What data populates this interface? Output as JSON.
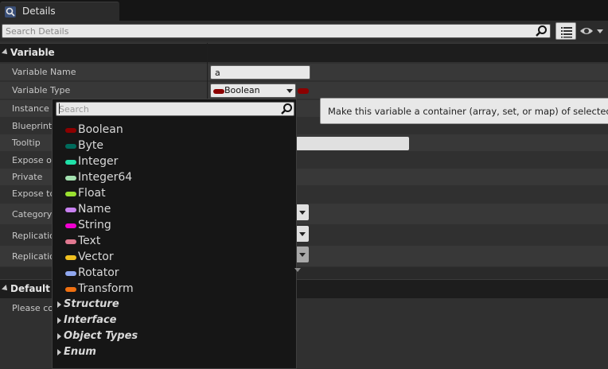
{
  "tab": {
    "title": "Details"
  },
  "search": {
    "placeholder": "Search Details"
  },
  "sections": {
    "variable": "Variable",
    "default_value": "Default V"
  },
  "rows": [
    {
      "label": "Variable Name"
    },
    {
      "label": "Variable Type"
    },
    {
      "label": "Instance E"
    },
    {
      "label": "Blueprint R"
    },
    {
      "label": "Tooltip"
    },
    {
      "label": "Expose on"
    },
    {
      "label": "Private"
    },
    {
      "label": "Expose to"
    },
    {
      "label": "Category"
    },
    {
      "label": "Replication"
    },
    {
      "label": "Replicatio"
    }
  ],
  "variable_name_value": "a",
  "variable_type_value": "Boolean",
  "default_value_note": "Please co",
  "container_tooltip": "Make this variable a container (array, set, or map) of selected type",
  "type_popup": {
    "search_placeholder": "Search",
    "types": [
      {
        "label": "Boolean",
        "color": "#8c0000"
      },
      {
        "label": "Byte",
        "color": "#006b5c"
      },
      {
        "label": "Integer",
        "color": "#1fe0a8"
      },
      {
        "label": "Integer64",
        "color": "#a3e0b0"
      },
      {
        "label": "Float",
        "color": "#9ae030"
      },
      {
        "label": "Name",
        "color": "#c880f0"
      },
      {
        "label": "String",
        "color": "#f000d0"
      },
      {
        "label": "Text",
        "color": "#e07890"
      },
      {
        "label": "Vector",
        "color": "#f0c020"
      },
      {
        "label": "Rotator",
        "color": "#90a8f0"
      },
      {
        "label": "Transform",
        "color": "#f07010"
      }
    ],
    "categories": [
      {
        "label": "Structure"
      },
      {
        "label": "Interface"
      },
      {
        "label": "Object Types"
      },
      {
        "label": "Enum"
      }
    ]
  },
  "colors": {
    "boolean_pin": "#8c0000",
    "panel_bg": "#303030",
    "header_bg": "#1d1d1d"
  }
}
